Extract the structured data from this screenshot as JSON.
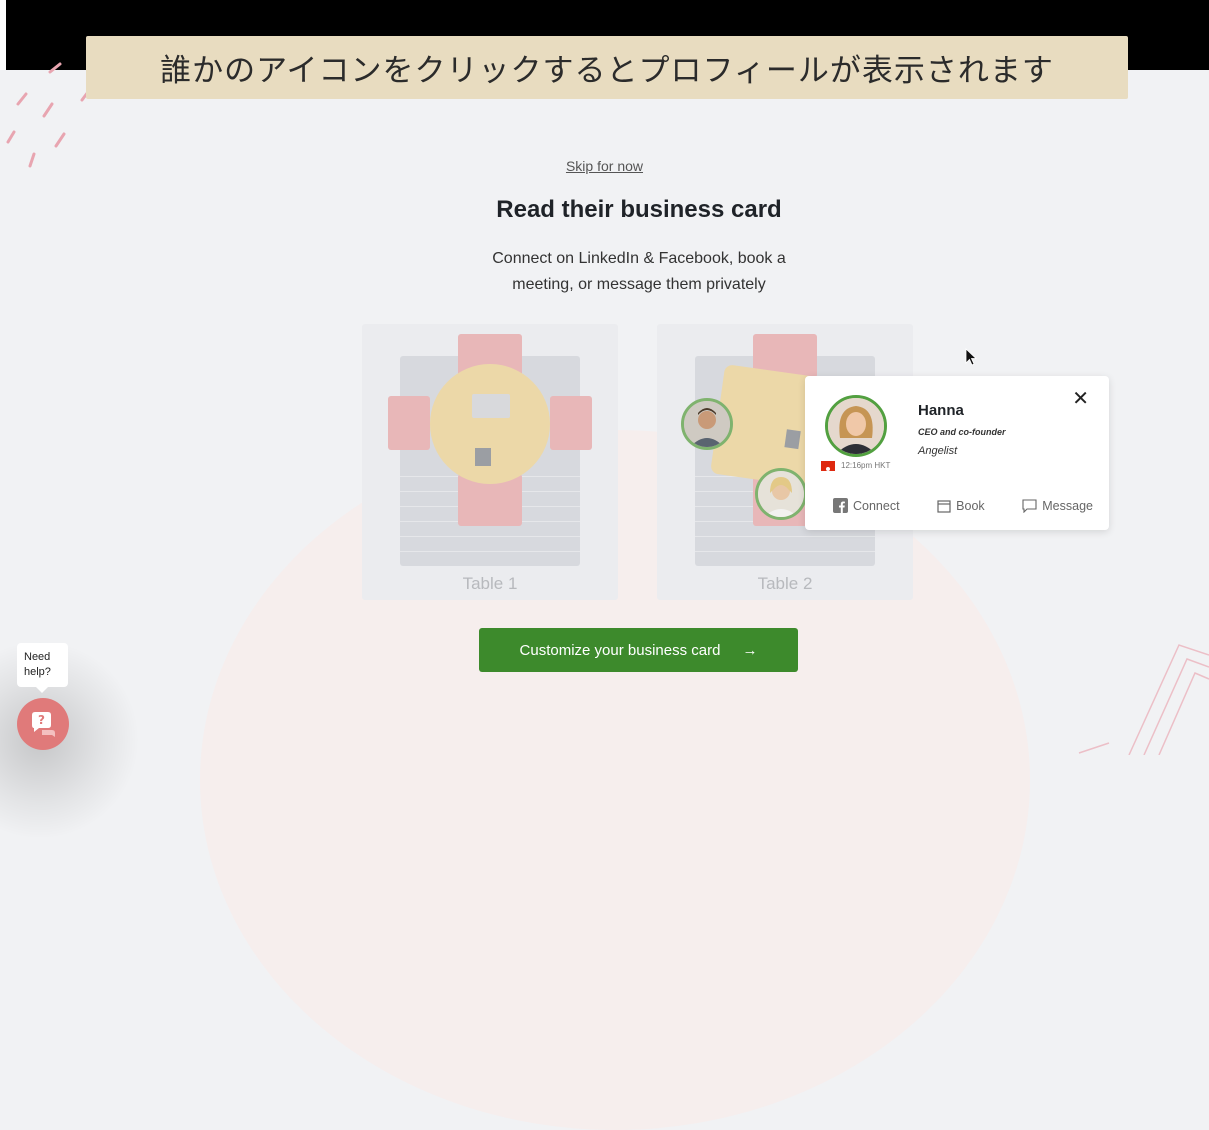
{
  "caption": {
    "text": "誰かのアイコンをクリックするとプロフィールが表示されます"
  },
  "onboarding": {
    "skip_label": "Skip for now",
    "title": "Read their business card",
    "subtitle_line1": "Connect on LinkedIn & Facebook, book a",
    "subtitle_line2": "meeting, or message them privately",
    "cta_label": "Customize your business card",
    "cta_arrow": "→"
  },
  "tables": [
    {
      "label": "Table 1"
    },
    {
      "label": "Table 2"
    }
  ],
  "profile_card": {
    "name": "Hanna",
    "role": "CEO and co-founder",
    "company": "Angelist",
    "local_time": "12:16pm HKT",
    "close_glyph": "✕",
    "actions": {
      "connect": "Connect",
      "book": "Book",
      "message": "Message"
    }
  },
  "help": {
    "line1": "Need",
    "line2": "help?"
  },
  "colors": {
    "caption_bg": "#e8dcc0",
    "cta_bg": "#3d8a2c",
    "avatar_ring": "#52a040",
    "help_button": "#e07a7a",
    "chair": "#e8b7b8",
    "table_top": "#ecd8a8"
  },
  "icons": [
    "close-icon",
    "facebook-icon",
    "calendar-icon",
    "message-icon",
    "arrow-right-icon",
    "question-icon",
    "hong-kong-flag-icon",
    "mouse-cursor-icon"
  ]
}
